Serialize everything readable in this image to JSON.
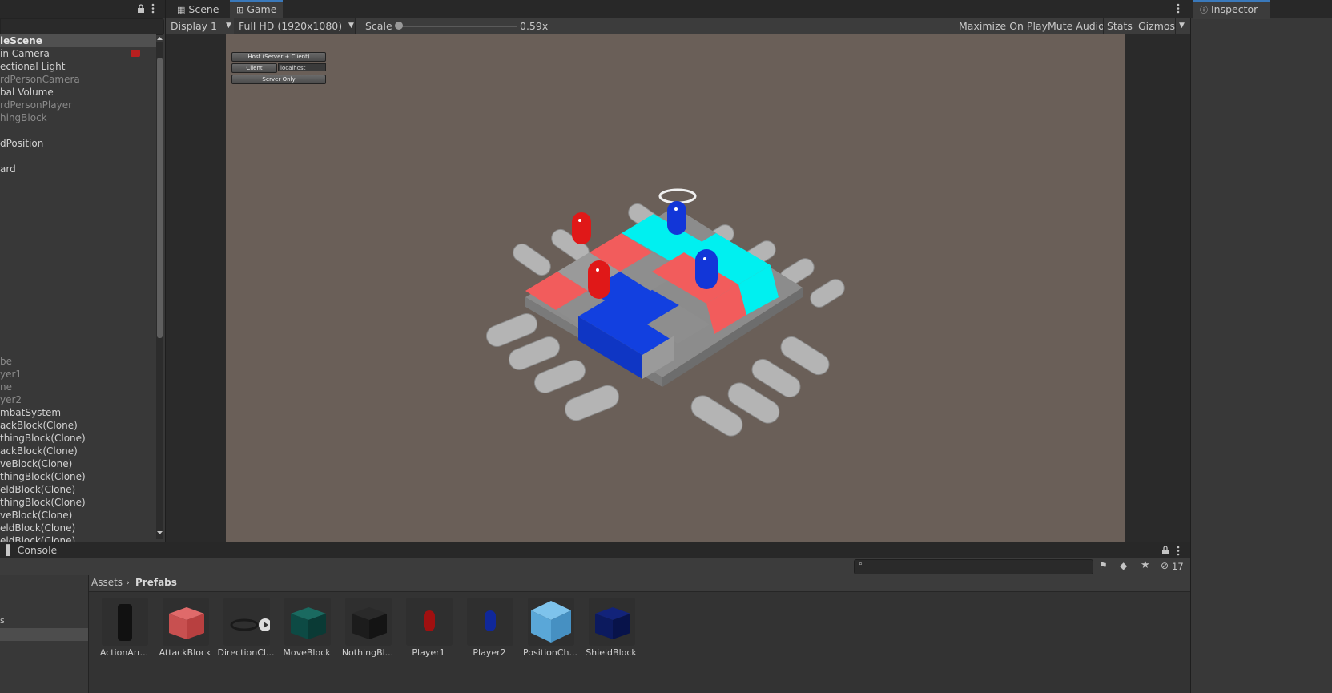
{
  "hierarchy": {
    "rows": [
      {
        "label": "leScene",
        "style": "scene"
      },
      {
        "label": "in Camera",
        "style": ""
      },
      {
        "label": "ectional Light",
        "style": ""
      },
      {
        "label": "rdPersonCamera",
        "style": "dim"
      },
      {
        "label": "bal Volume",
        "style": ""
      },
      {
        "label": "rdPersonPlayer",
        "style": "dim"
      },
      {
        "label": "hingBlock",
        "style": "dim"
      },
      {
        "label": "",
        "style": ""
      },
      {
        "label": "dPosition",
        "style": ""
      },
      {
        "label": "",
        "style": ""
      },
      {
        "label": "ard",
        "style": ""
      },
      {
        "label": "",
        "style": ""
      },
      {
        "label": "",
        "style": ""
      },
      {
        "label": "",
        "style": ""
      },
      {
        "label": "",
        "style": ""
      },
      {
        "label": "",
        "style": ""
      },
      {
        "label": "",
        "style": ""
      },
      {
        "label": "",
        "style": ""
      },
      {
        "label": "",
        "style": ""
      },
      {
        "label": "",
        "style": ""
      },
      {
        "label": "",
        "style": ""
      },
      {
        "label": "",
        "style": ""
      },
      {
        "label": "",
        "style": ""
      },
      {
        "label": "",
        "style": ""
      },
      {
        "label": "",
        "style": ""
      },
      {
        "label": "be",
        "style": "dim"
      },
      {
        "label": "yer1",
        "style": "dim"
      },
      {
        "label": "ne",
        "style": "dim"
      },
      {
        "label": "yer2",
        "style": "dim"
      },
      {
        "label": "mbatSystem",
        "style": ""
      },
      {
        "label": "ackBlock(Clone)",
        "style": ""
      },
      {
        "label": "thingBlock(Clone)",
        "style": ""
      },
      {
        "label": "ackBlock(Clone)",
        "style": ""
      },
      {
        "label": "veBlock(Clone)",
        "style": ""
      },
      {
        "label": "thingBlock(Clone)",
        "style": ""
      },
      {
        "label": "eldBlock(Clone)",
        "style": ""
      },
      {
        "label": "thingBlock(Clone)",
        "style": ""
      },
      {
        "label": "veBlock(Clone)",
        "style": ""
      },
      {
        "label": "eldBlock(Clone)",
        "style": ""
      },
      {
        "label": "eldBlock(Clone)",
        "style": ""
      }
    ]
  },
  "tabs": {
    "scene": "Scene",
    "game": "Game",
    "inspector": "Inspector",
    "console": "Console"
  },
  "game_toolbar": {
    "display": "Display 1",
    "resolution": "Full HD (1920x1080)",
    "scale_label": "Scale",
    "scale_value": "0.59x",
    "maximize": "Maximize On Play",
    "mute": "Mute Audio",
    "stats": "Stats",
    "gizmos": "Gizmos"
  },
  "game_gui": {
    "host": "Host (Server + Client)",
    "client": "Client",
    "address": "localhost",
    "server": "Server Only"
  },
  "project": {
    "breadcrumb_root": "Assets",
    "breadcrumb_current": "Prefabs",
    "hidden_count": "17",
    "assets": [
      {
        "label": "ActionArr...",
        "kind": "arrow"
      },
      {
        "label": "AttackBlock",
        "kind": "red-cube"
      },
      {
        "label": "DirectionCl...",
        "kind": "ring"
      },
      {
        "label": "MoveBlock",
        "kind": "teal-cube"
      },
      {
        "label": "NothingBl...",
        "kind": "dark-cube"
      },
      {
        "label": "Player1",
        "kind": "red-capsule"
      },
      {
        "label": "Player2",
        "kind": "blue-capsule"
      },
      {
        "label": "PositionCh...",
        "kind": "prefab-cube"
      },
      {
        "label": "ShieldBlock",
        "kind": "navy-cube"
      }
    ]
  },
  "colors": {
    "attack": "#f25c5c",
    "move": "#00f0f0",
    "shield": "#1240e0",
    "nothing": "#8e8e8e",
    "player1": "#e01818",
    "player2": "#1236d8"
  }
}
